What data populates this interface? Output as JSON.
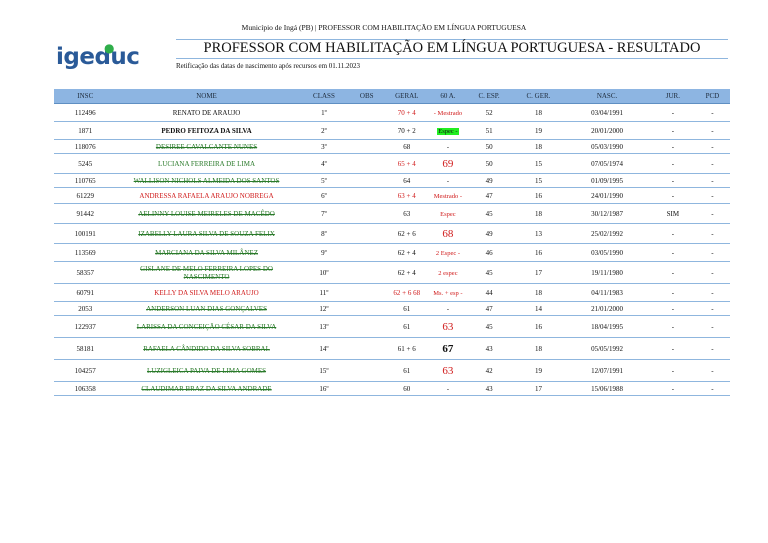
{
  "header": {
    "top_line": "Município de Ingá (PB) | PROFESSOR COM HABILITAÇÃO EM LÍNGUA PORTUGUESA",
    "logo_text": "igeduc",
    "title": "PROFESSOR COM HABILITAÇÃO EM LÍNGUA PORTUGUESA - RESULTADO",
    "subtitle": "Retificação das datas de nascimento após recursos em 01.11.2023"
  },
  "table": {
    "headers": [
      "INSC",
      "NOME",
      "CLASS",
      "OBS",
      "GERAL",
      "60 A.",
      "C. ESP.",
      "C. GER.",
      "NASC.",
      "JUR.",
      "PCD"
    ],
    "rows": [
      {
        "insc": "112496",
        "name": "RENATO DE ARAUJO",
        "class": "1º",
        "obs": "",
        "geral": "70 + 4",
        "note": "- Mestrado",
        "esp": "52",
        "ger": "18",
        "nasc": "03/04/1991",
        "jur": "-",
        "pcd": "-"
      },
      {
        "insc": "1871",
        "name": "PEDRO FEITOZA DA SILVA",
        "class": "2º",
        "obs": "",
        "geral": "70 + 2",
        "note": "Espec -",
        "esp": "51",
        "ger": "19",
        "nasc": "20/01/2000",
        "jur": "-",
        "pcd": "-"
      },
      {
        "insc": "118076",
        "name": "DESIREE CAVALCANTE NUNES",
        "class": "3º",
        "obs": "",
        "geral": "68",
        "note": "-",
        "esp": "50",
        "ger": "18",
        "nasc": "05/03/1990",
        "jur": "-",
        "pcd": "-"
      },
      {
        "insc": "5245",
        "name": "LUCIANA FERREIRA DE LIMA",
        "class": "4º",
        "obs": "",
        "geral": "65 + 4",
        "note": "69",
        "esp": "50",
        "ger": "15",
        "nasc": "07/05/1974",
        "jur": "-",
        "pcd": "-"
      },
      {
        "insc": "110765",
        "name": "WALLISON NICHOLS ALMEIDA DOS SANTOS",
        "class": "5º",
        "obs": "",
        "geral": "64",
        "note": "-",
        "esp": "49",
        "ger": "15",
        "nasc": "01/09/1995",
        "jur": "-",
        "pcd": "-"
      },
      {
        "insc": "61229",
        "name": "ANDRESSA RAFAELA ARAUJO NOBREGA",
        "class": "6º",
        "obs": "",
        "geral": "63 + 4",
        "note": "Mestrado -",
        "esp": "47",
        "ger": "16",
        "nasc": "24/01/1990",
        "jur": "-",
        "pcd": "-"
      },
      {
        "insc": "91442",
        "name": "AELINNY LOUISE MEIRELES DE MACÊDO",
        "class": "7º",
        "obs": "",
        "geral": "63",
        "note": "Espec",
        "esp": "45",
        "ger": "18",
        "nasc": "30/12/1987",
        "jur": "SIM",
        "pcd": "-"
      },
      {
        "insc": "100191",
        "name": "IZABELLY LAURA SILVA DE SOUZA FELIX",
        "class": "8º",
        "obs": "",
        "geral": "62 + 6",
        "note": "68",
        "esp": "49",
        "ger": "13",
        "nasc": "25/02/1992",
        "jur": "-",
        "pcd": "-"
      },
      {
        "insc": "113569",
        "name": "MARCIANA DA SILVA MILÂNEZ",
        "class": "9º",
        "obs": "",
        "geral": "62 + 4",
        "note": "2 Espec -",
        "esp": "46",
        "ger": "16",
        "nasc": "03/05/1990",
        "jur": "-",
        "pcd": "-"
      },
      {
        "insc": "58357",
        "name": "GISLANE DE MELO FERREIRA LOPES DO NASCIMENTO",
        "class": "10º",
        "obs": "",
        "geral": "62 + 4",
        "note": "2 espec",
        "esp": "45",
        "ger": "17",
        "nasc": "19/11/1980",
        "jur": "-",
        "pcd": "-"
      },
      {
        "insc": "60791",
        "name": "KELLY DA SILVA MELO ARAUJO",
        "class": "11º",
        "obs": "",
        "geral": "62 + 6",
        "geral_extra": "68",
        "note": "Ms. + esp -",
        "esp": "44",
        "ger": "18",
        "nasc": "04/11/1983",
        "jur": "-",
        "pcd": "-"
      },
      {
        "insc": "2053",
        "name": "ANDERSON LUAN DIAS GONÇALVES",
        "class": "12º",
        "obs": "",
        "geral": "61",
        "note": "-",
        "esp": "47",
        "ger": "14",
        "nasc": "21/01/2000",
        "jur": "-",
        "pcd": "-"
      },
      {
        "insc": "122937",
        "name": "LARISSA DA CONCEIÇÃO CÉSAR DA SILVA",
        "class": "13º",
        "obs": "",
        "geral": "61",
        "note": "63",
        "esp": "45",
        "ger": "16",
        "nasc": "18/04/1995",
        "jur": "-",
        "pcd": "-"
      },
      {
        "insc": "58181",
        "name": "RAFAELA CÂNDIDO DA SILVA SOBRAL",
        "class": "14º",
        "obs": "",
        "geral": "61 + 6",
        "note": "67",
        "esp": "43",
        "ger": "18",
        "nasc": "05/05/1992",
        "jur": "-",
        "pcd": "-"
      },
      {
        "insc": "104257",
        "name": "LUZIGLEICA PAIVA DE LIMA GOMES",
        "class": "15º",
        "obs": "",
        "geral": "61",
        "note": "63",
        "esp": "42",
        "ger": "19",
        "nasc": "12/07/1991",
        "jur": "-",
        "pcd": "-"
      },
      {
        "insc": "106358",
        "name": "CLAUDIMAR BRAZ DA SILVA ANDRADE",
        "class": "16º",
        "obs": "",
        "geral": "60",
        "note": "-",
        "esp": "43",
        "ger": "17",
        "nasc": "15/06/1988",
        "jur": "-",
        "pcd": "-"
      }
    ]
  },
  "colors": {
    "header_bg": "#8db5e2",
    "logo_blue": "#2a5a98",
    "annotation_red": "#d01a1a",
    "strike_green": "#2a7a2a",
    "highlight_green": "#22ee22"
  }
}
